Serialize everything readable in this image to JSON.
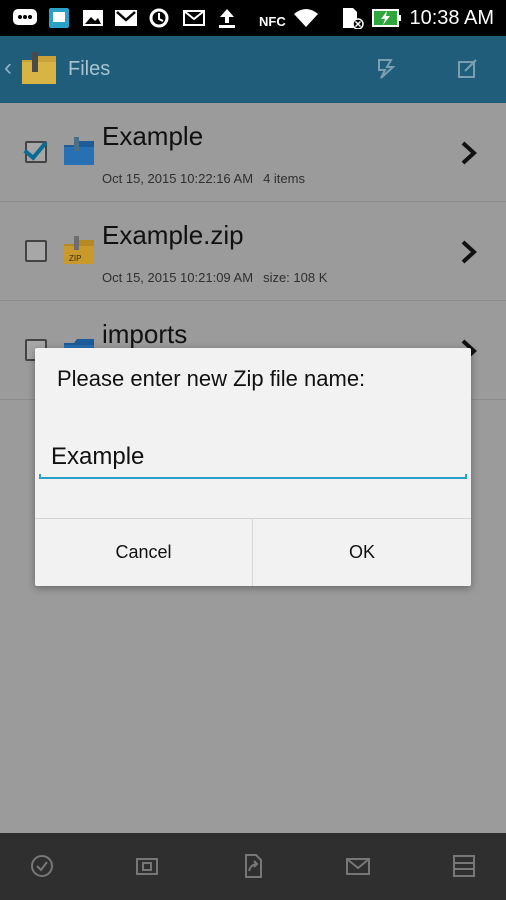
{
  "status_bar": {
    "time": "10:38 AM",
    "icons": [
      "chat-icon",
      "screenshot-icon",
      "image-icon",
      "gmail-icon",
      "sync-icon",
      "email-icon",
      "upload-icon",
      "nfc-icon",
      "wifi-icon",
      "sim-no-service-icon",
      "battery-charging-icon"
    ],
    "nfc_label": "NFC"
  },
  "action_bar": {
    "title": "Files",
    "back_icon": "chevron-left-icon",
    "app_icon": "folder-icon",
    "buttons": [
      "refresh-icon",
      "edit-icon"
    ],
    "color": "#1f5d7a"
  },
  "files": [
    {
      "name": "Example",
      "date": "Oct 15, 2015 10:22:16 AM",
      "info": "4 items",
      "checked": true,
      "type": "folder"
    },
    {
      "name": "Example.zip",
      "date": "Oct 15, 2015 10:21:09 AM",
      "info": "size: 108 K",
      "checked": false,
      "type": "zip",
      "zip_badge": "ZIP"
    },
    {
      "name": "imports",
      "date": "",
      "info": "",
      "checked": false,
      "type": "folder"
    }
  ],
  "dialog": {
    "title": "Please enter new Zip file name:",
    "input_value": "Example",
    "cancel_label": "Cancel",
    "ok_label": "OK",
    "accent": "#2aa2c8"
  },
  "bottom_bar": {
    "icons": [
      "select-all-icon",
      "compress-icon",
      "share-icon",
      "mail-icon",
      "more-icon"
    ]
  }
}
